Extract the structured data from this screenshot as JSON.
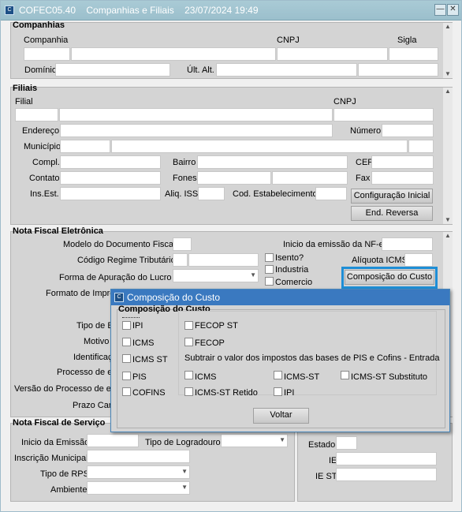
{
  "window": {
    "app_code": "COFEC05.40",
    "title": "Companhias e Filiais",
    "date_time": "23/07/2024 19:49"
  },
  "companhias": {
    "section_title": "Companhias",
    "companhia_label": "Companhia",
    "cnpj_label": "CNPJ",
    "sigla_label": "Sigla",
    "dominio_label": "Domínio",
    "ult_alt_label": "Últ. Alt."
  },
  "filiais": {
    "section_title": "Filiais",
    "filial_label": "Filial",
    "cnpj_label": "CNPJ",
    "endereco_label": "Endereço",
    "numero_label": "Número",
    "municipio_label": "Município",
    "compl_label": "Compl.",
    "bairro_label": "Bairro",
    "cep_label": "CEP",
    "contato_label": "Contato",
    "fones_label": "Fones",
    "fax_label": "Fax",
    "ins_est_label": "Ins.Est.",
    "aliq_iss_label": "Aliq. ISS",
    "cod_estab_label": "Cod. Estabelecimento",
    "config_inicial_button": "Configuração Inicial",
    "end_reversa_button": "End. Reversa"
  },
  "nfe": {
    "section_title": "Nota Fiscal Eletrônica",
    "modelo_doc_label": "Modelo do Documento Fiscal",
    "inicio_emissao_label": "Inicio da emissão da NF-e",
    "regime_trib_label": "Código Regime Tributário",
    "isento_label": "Isento?",
    "aliquota_icms_label": "Alíquota ICMS",
    "industria_label": "Industria",
    "forma_apuracao_label": "Forma de Apuração do Lucro",
    "comercio_label": "Comercio",
    "composicao_button": "Composição do Custo",
    "formato_impressao_label": "Formato de Impre",
    "tipo_label": "Tipo de E",
    "motivo_label": "Motivo",
    "identificacao_label": "Identificaç",
    "processo_label": "Processo de e",
    "versao_processo_label": "Versão do Processo de e",
    "prazo_label": "Prazo Can"
  },
  "nfs": {
    "section_title": "Nota Fiscal de Serviço",
    "inicio_emissao_label": "Inicio da Emissão",
    "tipo_logradouro_label": "Tipo de Logradouro",
    "inscricao_municipal_label": "Inscrição Municipal",
    "tipo_rps_label": "Tipo de RPS",
    "ambiente_label": "Ambiente",
    "estado_label": "Estado",
    "ie_label": "IE",
    "ie_st_label": "IE ST"
  },
  "dialog": {
    "title": "Composição do Custo",
    "group_title": "Composição do Custo",
    "ipi_label": "IPI",
    "fecop_st_label": "FECOP ST",
    "icms_label": "ICMS",
    "fecop_label": "FECOP",
    "icms_st_label": "ICMS ST",
    "subtrair_label": "Subtrair o valor dos impostos das bases de PIS e Cofins - Entrada",
    "pis_label": "PIS",
    "sub_icms_label": "ICMS",
    "sub_icms_st_label": "ICMS-ST",
    "sub_icms_st_substituto_label": "ICMS-ST Substituto",
    "cofins_label": "COFINS",
    "sub_icms_st_retido_label": "ICMS-ST Retido",
    "sub_ipi_label": "IPI",
    "voltar_button": "Voltar"
  },
  "icons": {
    "app": "app-icon",
    "minimize": "minimize-icon",
    "close": "close-icon",
    "dropdown": "chevron-down-icon"
  },
  "colors": {
    "titlebar": "#9bbfcc",
    "dialog_title": "#3a79c0",
    "focus_border": "#1e8ed6"
  }
}
